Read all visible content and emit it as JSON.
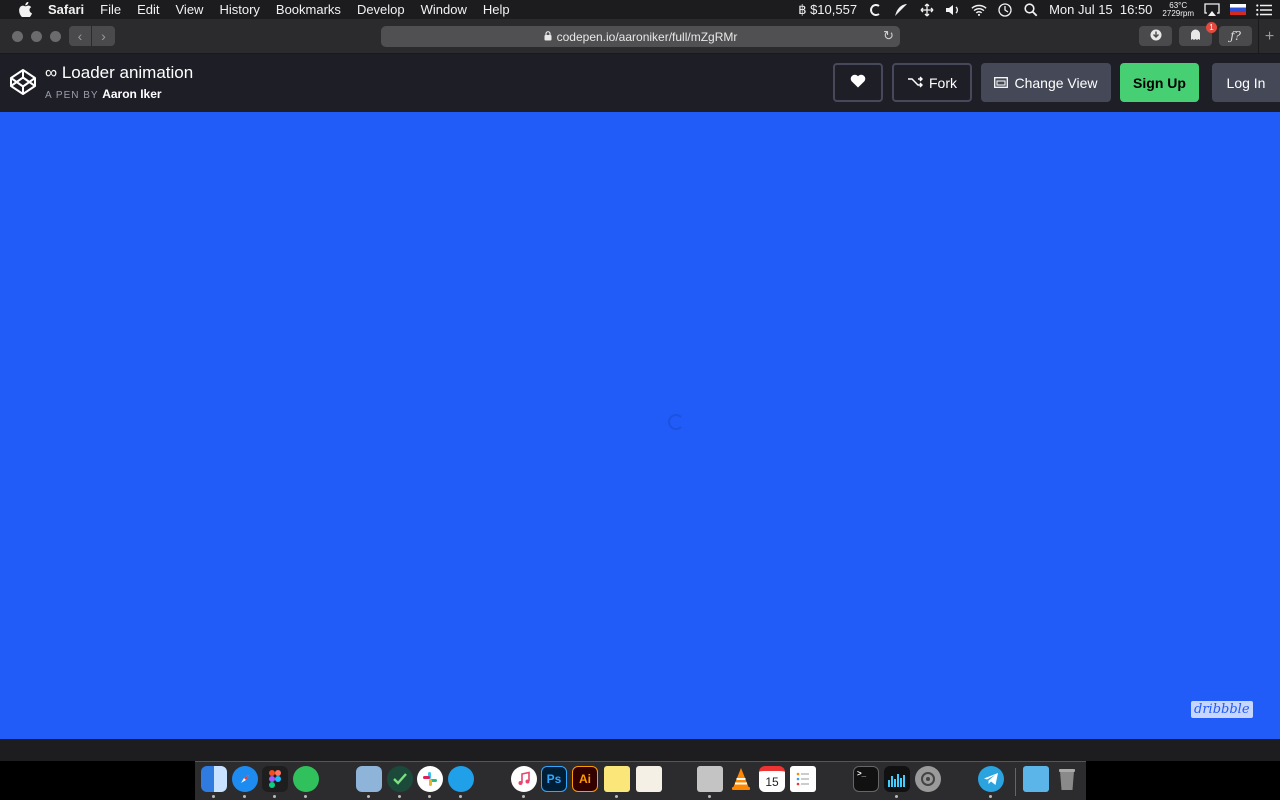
{
  "menubar": {
    "app_name": "Safari",
    "menus": [
      "File",
      "Edit",
      "View",
      "History",
      "Bookmarks",
      "Develop",
      "Window",
      "Help"
    ],
    "btc_price": "฿ $10,557",
    "temp": "63°C",
    "rpm": "2729rpm",
    "clock": "Mon Jul 15  16:50"
  },
  "safari": {
    "url": "codepen.io/aaroniker/full/mZgRMr",
    "notification_badge": "1",
    "script_button": "ƒ?"
  },
  "codepen": {
    "title": "∞ Loader animation",
    "byline_prefix": "A PEN BY",
    "author": "Aaron Iker",
    "fork_label": "Fork",
    "change_view_label": "Change View",
    "sign_up_label": "Sign Up",
    "log_in_label": "Log In"
  },
  "pen": {
    "background_color": "#215cf9",
    "watermark": "dribbble"
  },
  "dock": {
    "apps": [
      {
        "name": "finder",
        "label": ""
      },
      {
        "name": "safari",
        "label": ""
      },
      {
        "name": "figma",
        "label": ""
      },
      {
        "name": "messages-green",
        "label": ""
      },
      {
        "name": "preview",
        "label": ""
      },
      {
        "name": "things",
        "label": ""
      },
      {
        "name": "slack",
        "label": ""
      },
      {
        "name": "cleanmymac",
        "label": ""
      },
      {
        "name": "itunes",
        "label": ""
      },
      {
        "name": "photoshop",
        "label": "Ps"
      },
      {
        "name": "illustrator",
        "label": "Ai"
      },
      {
        "name": "notes",
        "label": ""
      },
      {
        "name": "textedit",
        "label": ""
      },
      {
        "name": "script-editor",
        "label": ""
      },
      {
        "name": "vlc",
        "label": ""
      },
      {
        "name": "calendar",
        "label": "15"
      },
      {
        "name": "reminders",
        "label": ""
      },
      {
        "name": "terminal",
        "label": ""
      },
      {
        "name": "activity-monitor",
        "label": ""
      },
      {
        "name": "system-preferences",
        "label": ""
      },
      {
        "name": "telegram",
        "label": ""
      },
      {
        "name": "downloads-folder",
        "label": ""
      },
      {
        "name": "trash",
        "label": ""
      }
    ]
  }
}
